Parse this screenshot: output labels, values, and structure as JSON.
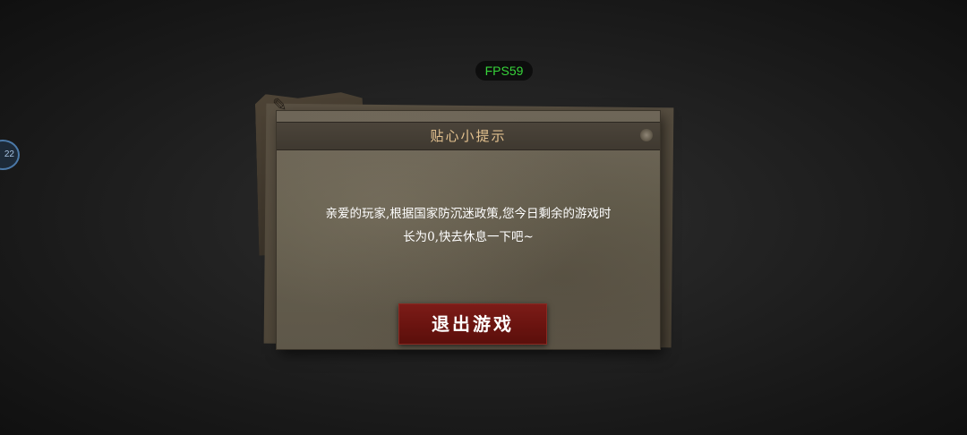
{
  "overlay": {
    "fps_label": "FPS59",
    "side_badge_text": "22"
  },
  "dialog": {
    "title": "贴心小提示",
    "message_line1": "亲爱的玩家,根据国家防沉迷政策,您今日剩余的游戏时",
    "message_line2": "长为0,快去休息一下吧~",
    "exit_button_label": "退出游戏"
  },
  "colors": {
    "fps_text": "#37d43a",
    "title_text": "#e2c08e",
    "button_bg": "#6e1611"
  },
  "icons": {
    "side_badge": "floating-assistant-icon"
  }
}
